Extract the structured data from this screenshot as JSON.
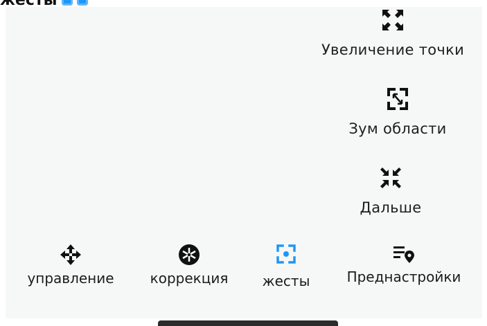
{
  "header": {
    "title": "жесты"
  },
  "menu": {
    "items": [
      {
        "label": "Увеличение точки",
        "icon": "expand-icon"
      },
      {
        "label": "Зум области",
        "icon": "zoom-area-icon"
      },
      {
        "label": "Дальше",
        "icon": "collapse-icon"
      }
    ]
  },
  "bottom_nav": {
    "items": [
      {
        "label": "управление",
        "icon": "move-arrows-icon"
      },
      {
        "label": "коррекция",
        "icon": "aperture-icon"
      },
      {
        "label": "жесты",
        "icon": "focus-target-icon",
        "active": true
      },
      {
        "label": "Преднастройки",
        "icon": "list-location-icon"
      }
    ]
  },
  "colors": {
    "accent": "#2196f3",
    "panel_bg": "#f6f8f8",
    "text": "#1b1b1b"
  }
}
